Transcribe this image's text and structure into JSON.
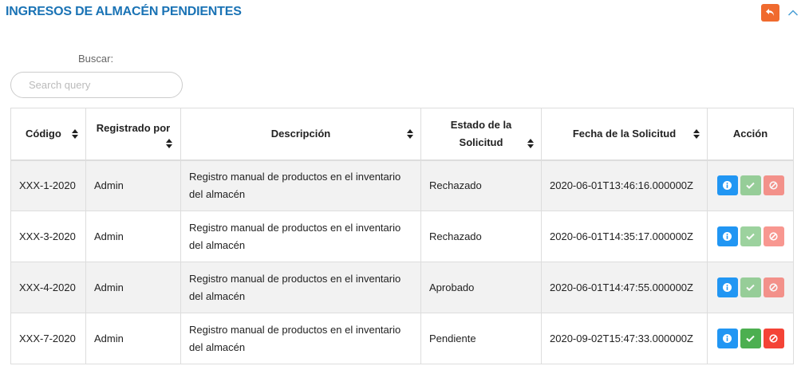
{
  "header": {
    "title": "INGRESOS DE ALMACÉN PENDIENTES",
    "back_icon": "undo-icon",
    "collapse_icon": "chevron-up-icon",
    "accent_color": "#f06a2e",
    "title_color": "#1a73b5"
  },
  "search": {
    "label": "Buscar:",
    "placeholder": "Search query",
    "value": ""
  },
  "table": {
    "columns": {
      "codigo": "Código",
      "registrado": "Registrado por",
      "descripcion": "Descripción",
      "estado_1": "Estado de la",
      "estado_2": "Solicitud",
      "fecha": "Fecha de la Solicitud",
      "accion": "Acción"
    },
    "rows": [
      {
        "codigo": "XXX-1-2020",
        "registrado": "Admin",
        "descripcion_1": "Registro manual de productos en el inventario",
        "descripcion_2": "del almacén",
        "estado": "Rechazado",
        "fecha": "2020-06-01T13:46:16.000000Z",
        "actions_enabled": false
      },
      {
        "codigo": "XXX-3-2020",
        "registrado": "Admin",
        "descripcion_1": "Registro manual de productos en el inventario",
        "descripcion_2": "del almacén",
        "estado": "Rechazado",
        "fecha": "2020-06-01T14:35:17.000000Z",
        "actions_enabled": false
      },
      {
        "codigo": "XXX-4-2020",
        "registrado": "Admin",
        "descripcion_1": "Registro manual de productos en el inventario",
        "descripcion_2": "del almacén",
        "estado": "Aprobado",
        "fecha": "2020-06-01T14:47:55.000000Z",
        "actions_enabled": false
      },
      {
        "codigo": "XXX-7-2020",
        "registrado": "Admin",
        "descripcion_1": "Registro manual de productos en el inventario",
        "descripcion_2": "del almacén",
        "estado": "Pendiente",
        "fecha": "2020-09-02T15:47:33.000000Z",
        "actions_enabled": true
      }
    ]
  }
}
